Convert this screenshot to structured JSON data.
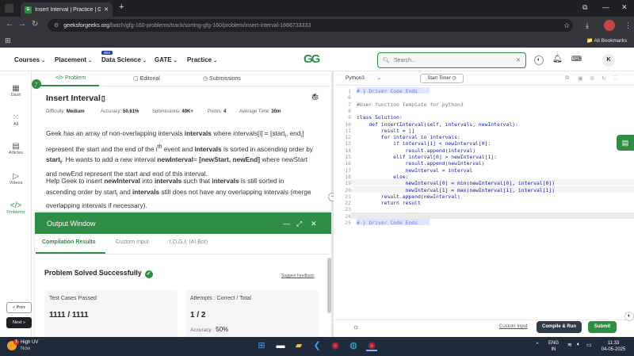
{
  "browser": {
    "tab_title": "Insert Interval | Practice | Geeks",
    "new_tab": "+",
    "url_domain": "geeksforgeeks.org",
    "url_path": "/batch/gfg-160-problems/track/sorting-gfg-160/problem/insert-interval-1666733333",
    "bookmarks_label": "All Bookmarks"
  },
  "header": {
    "nav": [
      "Courses",
      "Placement",
      "Data Science",
      "GATE",
      "Practice"
    ],
    "ibm_badge": "IBM",
    "logo": "GG",
    "search_placeholder": "Search...",
    "avatar": "K"
  },
  "sidebar": {
    "items": [
      {
        "label": "Dash",
        "icon": "grid-icon"
      },
      {
        "label": "All",
        "icon": "dots-grid-icon"
      },
      {
        "label": "Articles",
        "icon": "article-icon"
      },
      {
        "label": "Videos",
        "icon": "video-icon"
      },
      {
        "label": "Problems",
        "icon": "code-icon"
      }
    ],
    "prev": "« Prev",
    "next": "Next »"
  },
  "problem": {
    "tabs": [
      "Problem",
      "Editorial",
      "Submissions"
    ],
    "title": "Insert Interval",
    "difficulty_label": "Difficulty:",
    "difficulty": "Medium",
    "accuracy_label": "Accuracy:",
    "accuracy": "50.61%",
    "submissions_label": "Submissions:",
    "submissions": "40K+",
    "points_label": "Points:",
    "points": "4",
    "avg_time_label": "Average Time:",
    "avg_time": "30m",
    "p1_a": "Geek has an array of non-overlapping intervals ",
    "p1_b": "intervals",
    "p1_c": " where intervals[i] = [start",
    "p1_d": "i",
    "p1_e": ", end",
    "p1_f": "i",
    "p1_g": "] represent the start and the end of the i",
    "p1_h": "th",
    "p1_i": " event and ",
    "p1_j": "intervals",
    "p1_k": " is sorted in ascending order by ",
    "p1_l": "start",
    "p1_m": "i",
    "p1_n": ". He wants to add a new interval ",
    "p1_o": "newInterval",
    "p1_p": "= ",
    "p1_q": "[newStart, newEnd]",
    "p1_r": " where newStart and newEnd represent the start and end of this interval.",
    "p2_a": "Help Geek to insert ",
    "p2_b": "newInterval",
    "p2_c": " into ",
    "p2_d": "intervals",
    "p2_e": " such that ",
    "p2_f": "intervals",
    "p2_g": " is still sorted in ascending order by start",
    "p2_h": "i",
    "p2_i": " and ",
    "p2_j": "intervals",
    "p2_k": " still does not have any overlapping intervals (merge overlapping intervals if necessary)."
  },
  "output": {
    "title": "Output Window",
    "tabs": [
      "Compilation Results",
      "Custom Input",
      "Y.O.G.I. (AI Bot)"
    ],
    "status": "Problem Solved Successfully",
    "suggest": "Suggest Feedback",
    "tc_label": "Test Cases Passed",
    "tc_value": "1111 / 1111",
    "att_label": "Attempts : Correct / Total",
    "att_value": "1 / 2",
    "accuracy_label": "Accuracy :",
    "accuracy_value": "50%"
  },
  "editor": {
    "language": "Python3",
    "timer": "Start Timer",
    "lines": [
      {
        "n": "1",
        "t": "# } Driver Code Ends"
      },
      {
        "n": "6",
        "t": ""
      },
      {
        "n": "7",
        "t": "#User function Template for python3"
      },
      {
        "n": "8",
        "t": ""
      },
      {
        "n": "9",
        "t": "class Solution:"
      },
      {
        "n": "10",
        "t": "    def insertInterval(self, intervals, newInterval):"
      },
      {
        "n": "11",
        "t": "        result = []"
      },
      {
        "n": "12",
        "t": "        for interval in intervals:"
      },
      {
        "n": "13",
        "t": "            if interval[1] < newInterval[0]:"
      },
      {
        "n": "14",
        "t": "                result.append(interval)"
      },
      {
        "n": "15",
        "t": "            elif interval[0] > newInterval[1]:"
      },
      {
        "n": "16",
        "t": "                result.append(newInterval)"
      },
      {
        "n": "17",
        "t": "                newInterval = interval"
      },
      {
        "n": "18",
        "t": "            else:"
      },
      {
        "n": "19",
        "t": "                newInterval[0] = min(newInterval[0], interval[0])"
      },
      {
        "n": "20",
        "t": "                newInterval[1] = max(newInterval[1], interval[1])"
      },
      {
        "n": "21",
        "t": "        result.append(newInterval)"
      },
      {
        "n": "22",
        "t": "        return result"
      },
      {
        "n": "23",
        "t": ""
      },
      {
        "n": "24",
        "t": ""
      },
      {
        "n": "25",
        "t": "# } Driver Code Ends"
      }
    ],
    "custom_input": "Custom Input",
    "compile": "Compile & Run",
    "submit": "Submit"
  },
  "taskbar": {
    "weather_title": "High UV",
    "weather_sub": "Now",
    "weather_badge": "1",
    "lang": "ENG",
    "region": "IN",
    "time": "11:33",
    "date": "04-05-2025"
  },
  "colors": {
    "accent": "#2f8d46",
    "dark": "#1f2023"
  }
}
